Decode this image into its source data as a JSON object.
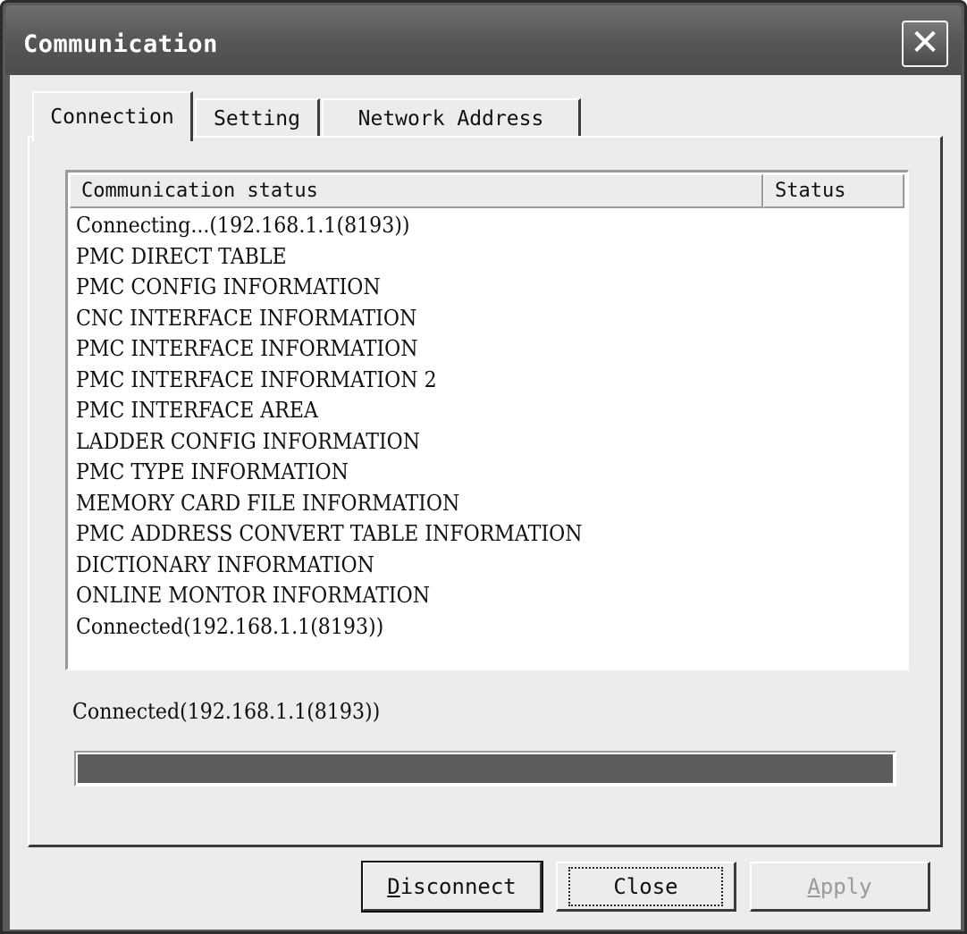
{
  "window": {
    "title": "Communication",
    "close_glyph": "✕"
  },
  "tabs": [
    {
      "label": "Connection",
      "active": true
    },
    {
      "label": "Setting",
      "active": false
    },
    {
      "label": "Network Address",
      "active": false
    }
  ],
  "listview": {
    "columns": [
      "Communication status",
      "Status"
    ],
    "rows": [
      "Connecting...(192.168.1.1(8193))",
      "PMC DIRECT TABLE",
      "PMC CONFIG INFORMATION",
      "CNC INTERFACE INFORMATION",
      "PMC INTERFACE INFORMATION",
      "PMC INTERFACE INFORMATION 2",
      "PMC INTERFACE AREA",
      "LADDER CONFIG INFORMATION",
      "PMC TYPE INFORMATION",
      "MEMORY CARD FILE INFORMATION",
      "PMC ADDRESS CONVERT TABLE INFORMATION",
      "DICTIONARY INFORMATION",
      "ONLINE MONTOR INFORMATION",
      "Connected(192.168.1.1(8193))"
    ]
  },
  "status_message": "Connected(192.168.1.1(8193))",
  "progress": {
    "fraction": 1.0
  },
  "buttons": {
    "disconnect": {
      "mnemonic": "D",
      "rest": "isconnect"
    },
    "close": "Close",
    "apply": {
      "mnemonic": "A",
      "rest": "pply"
    }
  },
  "icons": {
    "close": "close-icon"
  },
  "colors": {
    "titlebar": "#555555",
    "face": "#ececec",
    "progress_fill": "#5c5c5c"
  }
}
